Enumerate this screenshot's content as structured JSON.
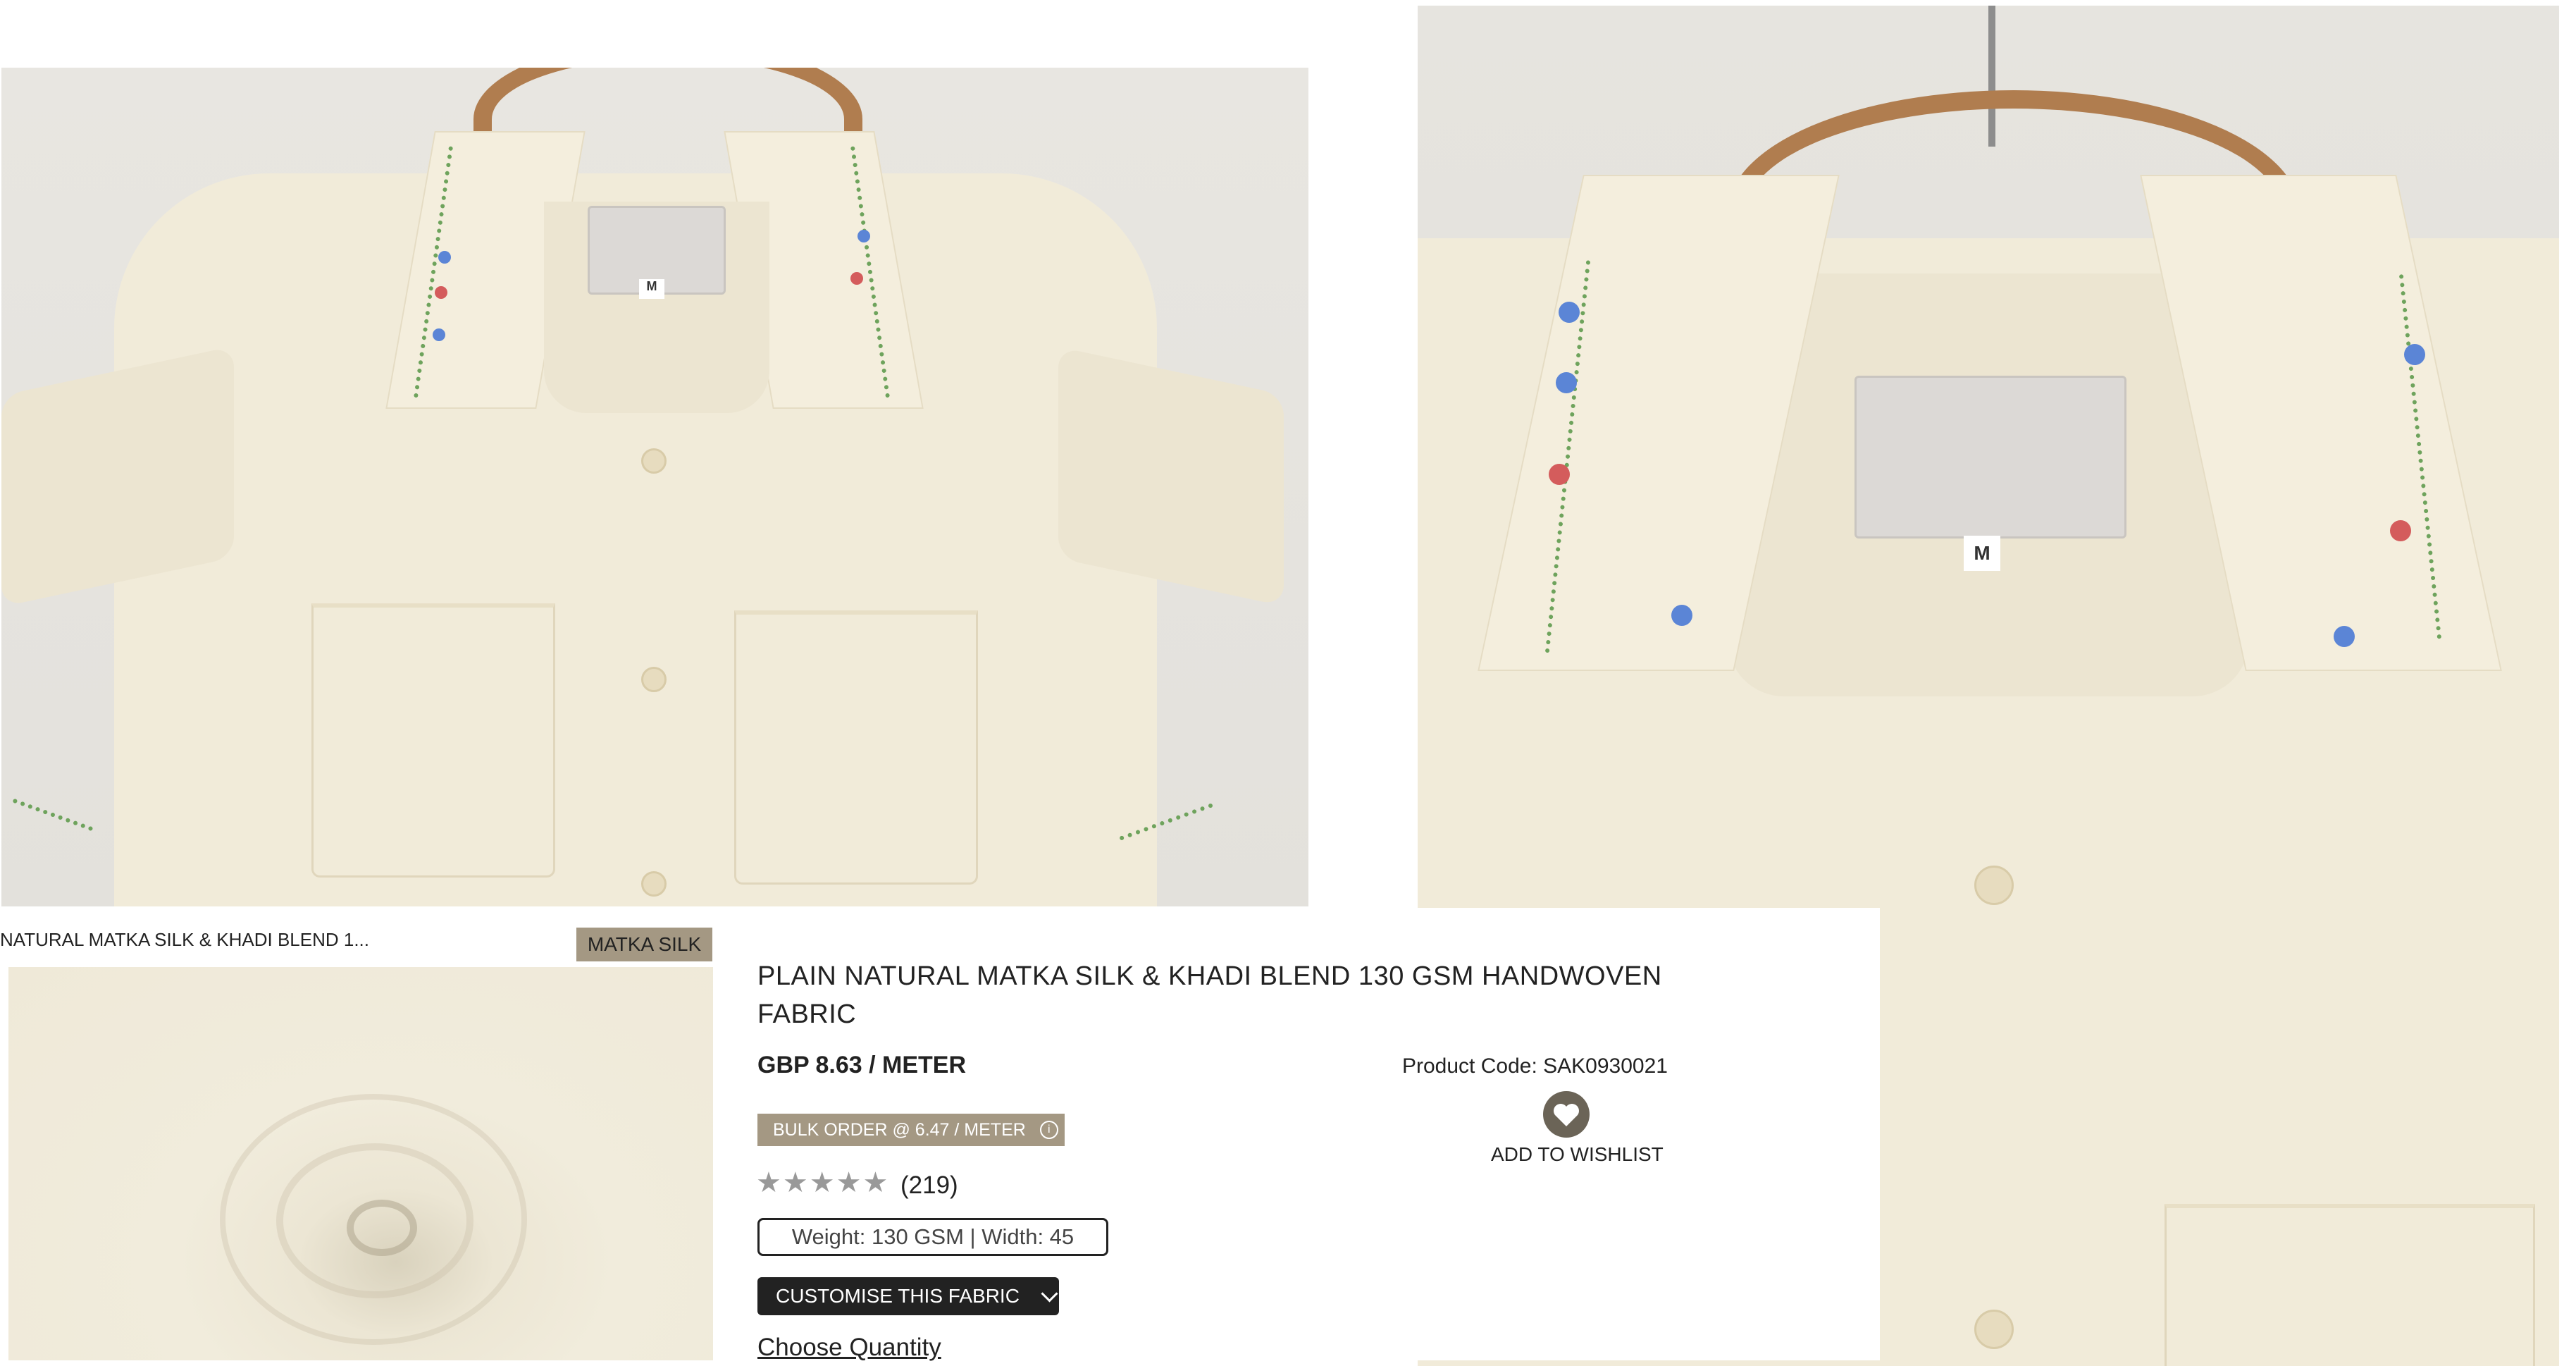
{
  "images": {
    "shirt_front_size": "M",
    "shirt_closeup_size": "M"
  },
  "product": {
    "list_title": "NATURAL MATKA SILK & KHADI BLEND 1...",
    "category_badge": "MATKA SILK",
    "title": "PLAIN NATURAL MATKA SILK & KHADI BLEND 130 GSM HANDWOVEN FABRIC",
    "price": "GBP 8.63 / METER",
    "product_code": "Product Code: SAK0930021",
    "bulk_order": "BULK ORDER @ 6.47 / METER",
    "info_icon": "i",
    "wishlist_label": "ADD TO WISHLIST",
    "stars": "★★★★★",
    "review_count": "(219)",
    "specs": "Weight: 130 GSM | Width: 45",
    "customise_button": "CUSTOMISE THIS FABRIC",
    "choose_quantity": "Choose Quantity"
  },
  "colors": {
    "badge_bg": "#a49883",
    "button_dark": "#222222",
    "heart": "#6b6457"
  },
  "icons": {
    "heart": "heart-icon",
    "chevron": "chevron-down-icon",
    "info": "info-icon",
    "star": "star-icon"
  }
}
